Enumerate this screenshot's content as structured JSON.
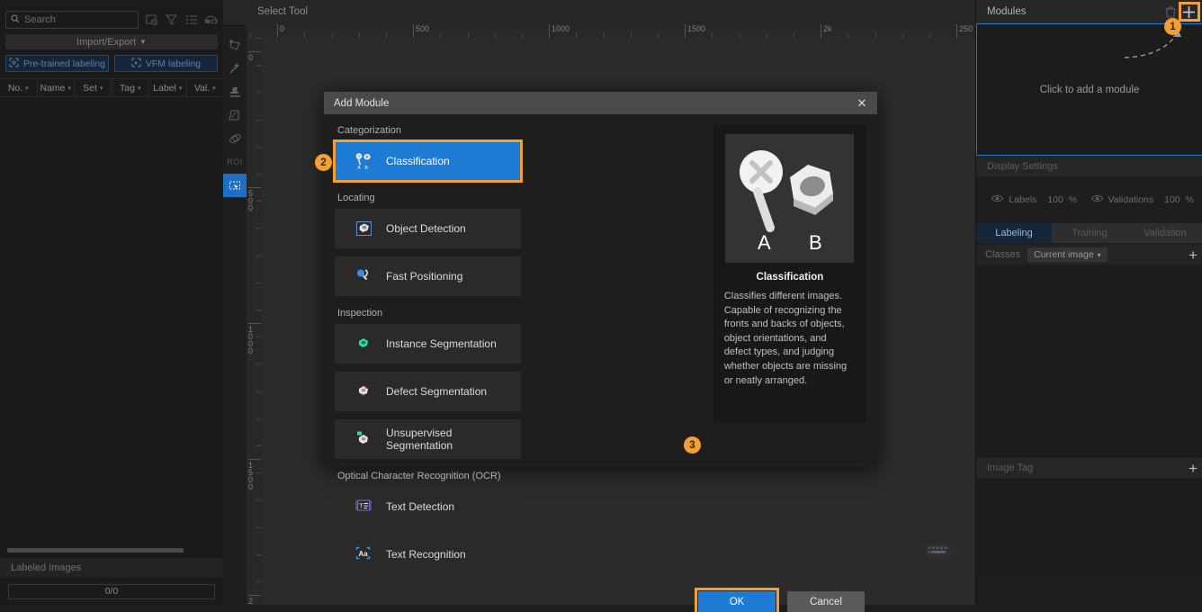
{
  "left_panel": {
    "search": {
      "placeholder": "Search",
      "icon": "search-icon"
    },
    "toolbar_icons": [
      "image-filter-icon",
      "funnel-filter-icon",
      "list-view-icon",
      "layout-view-icon"
    ],
    "import_export": {
      "label": "Import/Export",
      "caret": "▼"
    },
    "labeling_buttons": [
      {
        "label": "Pre-trained labeling",
        "icon": "pretrained-labeling-icon"
      },
      {
        "label": "VFM labeling",
        "icon": "vfm-labeling-icon"
      }
    ],
    "columns": [
      {
        "label": "No.",
        "caret": "▾"
      },
      {
        "label": "Name",
        "caret": "▾"
      },
      {
        "label": "Set",
        "caret": "▾"
      },
      {
        "label": "Tag",
        "caret": "▾"
      },
      {
        "label": "Label",
        "caret": "▾"
      },
      {
        "label": "Val.",
        "caret": "▾"
      }
    ],
    "labeled_images": {
      "title": "Labeled Images",
      "progress": "0/0"
    }
  },
  "vtoolbar": {
    "items": [
      {
        "name": "polygon-tool-icon",
        "selected": false
      },
      {
        "name": "magic-wand-tool-icon",
        "selected": false
      },
      {
        "name": "stamp-tool-icon",
        "selected": false
      },
      {
        "name": "eraser-shape-tool-icon",
        "selected": false
      },
      {
        "name": "ellipse-tool-icon",
        "selected": false
      },
      {
        "name": "roi-tool-icon",
        "selected": false,
        "label": "ROI"
      },
      {
        "name": "select-tool-icon",
        "selected": true
      }
    ]
  },
  "canvas": {
    "tool_title": "Select Tool",
    "h_ruler_labels": [
      "0",
      "500",
      "1000",
      "1500",
      "2k",
      "250"
    ],
    "v_ruler_labels": [
      "0",
      "500",
      "1000",
      "1500",
      "2"
    ],
    "keyboard_icon": "keyboard-icon"
  },
  "right_panel": {
    "modules": {
      "title": "Modules",
      "delete_icon": "trash-icon",
      "add_icon": "plus-icon",
      "empty_text": "Click to add a module"
    },
    "display_settings": {
      "title": "Display Settings",
      "items": [
        {
          "icon": "eye-icon",
          "label": "Labels",
          "value": "100",
          "unit": "%"
        },
        {
          "icon": "eye-icon",
          "label": "Validations",
          "value": "100",
          "unit": "%"
        }
      ]
    },
    "tabs": [
      {
        "label": "Labeling",
        "active": true
      },
      {
        "label": "Training",
        "active": false
      },
      {
        "label": "Validation",
        "active": false
      }
    ],
    "classes": {
      "label": "Classes",
      "scope": "Current image",
      "caret": "▾",
      "add_icon": "plus-icon"
    },
    "image_tag": {
      "title": "Image Tag",
      "add_icon": "plus-icon"
    }
  },
  "dialog": {
    "title": "Add Module",
    "close_icon": "close-icon",
    "sections": [
      {
        "heading": "Categorization",
        "cards": [
          {
            "label": "Classification",
            "icon": "classification-icon",
            "selected": true
          }
        ]
      },
      {
        "heading": "Locating",
        "cards": [
          {
            "label": "Object Detection",
            "icon": "object-detection-icon",
            "selected": false
          },
          {
            "label": "Fast Positioning",
            "icon": "fast-positioning-icon",
            "selected": false
          }
        ]
      },
      {
        "heading": "Inspection",
        "cards": [
          {
            "label": "Instance Segmentation",
            "icon": "instance-segmentation-icon",
            "selected": false
          },
          {
            "label": "Defect Segmentation",
            "icon": "defect-segmentation-icon",
            "selected": false
          },
          {
            "label": "Unsupervised Segmentation",
            "icon": "unsupervised-segmentation-icon",
            "selected": false
          }
        ]
      },
      {
        "heading": "Optical Character Recognition (OCR)",
        "cards": [
          {
            "label": "Text Detection",
            "icon": "text-detection-icon",
            "selected": false
          },
          {
            "label": "Text Recognition",
            "icon": "text-recognition-icon",
            "selected": false
          }
        ]
      }
    ],
    "preview": {
      "title": "Classification",
      "image_alt": "screw-and-nut-preview",
      "label_a": "A",
      "label_b": "B",
      "description": "Classifies different images. Capable of recognizing the fronts and backs of objects, object orientations, and defect types, and judging whether objects are missing or neatly arranged."
    },
    "buttons": {
      "ok": "OK",
      "cancel": "Cancel"
    }
  },
  "steps": [
    {
      "number": "1",
      "target": "add-module-plus-button"
    },
    {
      "number": "2",
      "target": "classification-card"
    },
    {
      "number": "3",
      "target": "ok-button"
    }
  ],
  "colors": {
    "accent_blue": "#1e7bd4",
    "highlight_orange": "#f2a033",
    "panel_bg": "#1e1e1e",
    "dialog_title_bg": "#4a4a4a"
  }
}
